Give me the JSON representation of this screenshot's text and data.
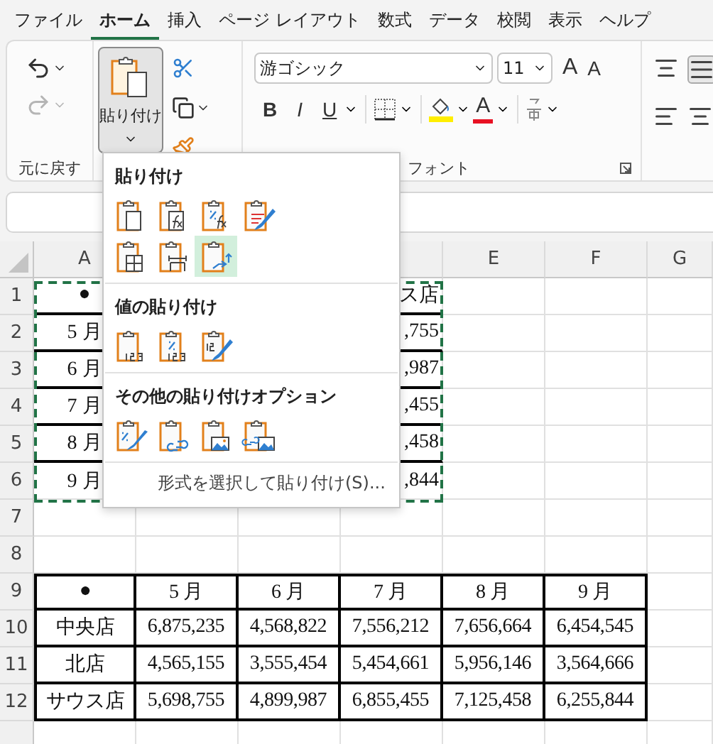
{
  "menu_tabs": [
    {
      "label": "ファイル",
      "selected": false
    },
    {
      "label": "ホーム",
      "selected": true
    },
    {
      "label": "挿入",
      "selected": false
    },
    {
      "label": "ページ レイアウト",
      "selected": false
    },
    {
      "label": "数式",
      "selected": false
    },
    {
      "label": "データ",
      "selected": false
    },
    {
      "label": "校閲",
      "selected": false
    },
    {
      "label": "表示",
      "selected": false
    },
    {
      "label": "ヘルプ",
      "selected": false
    }
  ],
  "ribbon": {
    "undo_label": "元に戻す",
    "redo": {
      "disabled": true
    },
    "paste_button": {
      "label": "貼り付け",
      "pressed": true
    },
    "font": {
      "name": "游ゴシック",
      "size": "11",
      "grow": "A",
      "shrink": "A",
      "bold": "B",
      "italic": "I",
      "underline": "U",
      "font_color": "A",
      "label": "フォント"
    }
  },
  "paste_menu": {
    "sections": [
      {
        "title": "貼り付け",
        "options": [
          {
            "kind": "all",
            "selected": false
          },
          {
            "kind": "formulas",
            "selected": false
          },
          {
            "kind": "formulas_number",
            "selected": false
          },
          {
            "kind": "keep_source",
            "selected": false
          },
          {
            "kind": "no_borders",
            "selected": false
          },
          {
            "kind": "column_widths",
            "selected": false
          },
          {
            "kind": "transpose",
            "selected": true
          }
        ]
      },
      {
        "title": "値の貼り付け",
        "options": [
          {
            "kind": "values",
            "selected": false
          },
          {
            "kind": "values_number",
            "selected": false
          },
          {
            "kind": "values_source",
            "selected": false
          }
        ]
      },
      {
        "title": "その他の貼り付けオプション",
        "options": [
          {
            "kind": "formatting",
            "selected": false
          },
          {
            "kind": "link",
            "selected": false
          },
          {
            "kind": "picture",
            "selected": false
          },
          {
            "kind": "linked_picture",
            "selected": false
          }
        ]
      }
    ],
    "footer": "形式を選択して貼り付け(S)..."
  },
  "sheet": {
    "columns": [
      "A",
      "E",
      "F",
      "G"
    ],
    "rows": [
      {
        "number": "1",
        "kind": "copied",
        "column_a": "●",
        "column_d": "ス店",
        "thick_bottom": true
      },
      {
        "number": "2",
        "kind": "copied",
        "column_a": "5 月",
        "column_d": ",755",
        "thick_bottom": true
      },
      {
        "number": "3",
        "kind": "copied",
        "column_a": "6 月",
        "column_d": ",987",
        "thick_bottom": true
      },
      {
        "number": "4",
        "kind": "copied",
        "column_a": "7 月",
        "column_d": ",455",
        "thick_bottom": true
      },
      {
        "number": "5",
        "kind": "copied",
        "column_a": "8 月",
        "column_d": ",458",
        "thick_bottom": true
      },
      {
        "number": "6",
        "kind": "copied",
        "column_a": "9 月",
        "column_d": ",844",
        "thick_bottom": false
      },
      {
        "number": "7",
        "kind": "empty"
      },
      {
        "number": "8",
        "kind": "empty"
      },
      {
        "number": "9",
        "kind": "table",
        "cells": [
          "●",
          "5 月",
          "6 月",
          "7 月",
          "8 月",
          "9 月"
        ]
      },
      {
        "number": "10",
        "kind": "table",
        "cells": [
          "中央店",
          "6,875,235",
          "4,568,822",
          "7,556,212",
          "7,656,664",
          "6,454,545"
        ]
      },
      {
        "number": "11",
        "kind": "table",
        "cells": [
          "北店",
          "4,565,155",
          "3,555,454",
          "5,454,661",
          "5,956,146",
          "3,564,666"
        ]
      },
      {
        "number": "12",
        "kind": "table",
        "cells": [
          "サウス店",
          "5,698,755",
          "4,899,987",
          "6,855,455",
          "7,125,458",
          "6,255,844"
        ]
      }
    ]
  }
}
